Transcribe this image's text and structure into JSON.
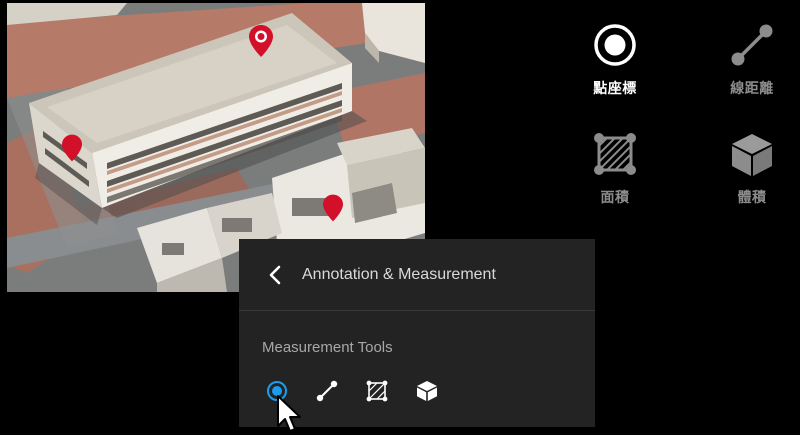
{
  "tools": [
    {
      "id": "point",
      "label": "點座標",
      "icon": "point-marker-icon",
      "active": true
    },
    {
      "id": "line",
      "label": "線距離",
      "icon": "line-distance-icon",
      "active": false
    },
    {
      "id": "area",
      "label": "面積",
      "icon": "area-polygon-icon",
      "active": false
    },
    {
      "id": "volume",
      "label": "體積",
      "icon": "volume-cube-icon",
      "active": false
    }
  ],
  "panel": {
    "title": "Annotation & Measurement",
    "section_label": "Measurement Tools",
    "back_icon": "chevron-left-icon",
    "tools": [
      "point-marker-icon",
      "line-distance-icon",
      "area-polygon-icon",
      "volume-cube-icon"
    ]
  },
  "colors": {
    "accent": "#1a9df0",
    "pin": "#d3102a",
    "panel_bg": "#232323",
    "inactive_label": "#8c8c8c"
  },
  "map": {
    "pins": 3,
    "pin_icon": "location-pin-icon"
  }
}
